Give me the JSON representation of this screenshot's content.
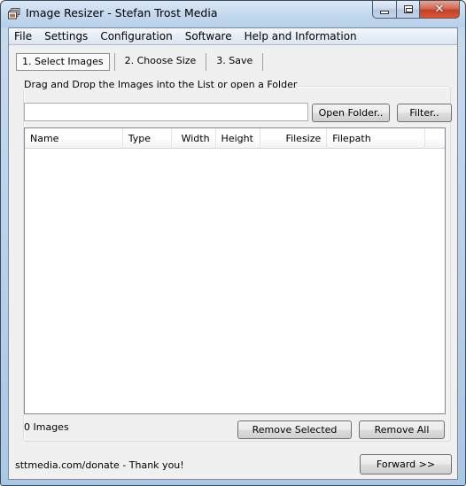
{
  "window": {
    "title": "Image Resizer - Stefan Trost Media",
    "controls": {
      "minimize": "minimize",
      "maximize": "maximize",
      "close": "✕"
    }
  },
  "menu": {
    "items": [
      {
        "label": "File"
      },
      {
        "label": "Settings"
      },
      {
        "label": "Configuration"
      },
      {
        "label": "Software"
      },
      {
        "label": "Help and Information"
      }
    ]
  },
  "tabs": [
    {
      "label": "1. Select Images",
      "active": true
    },
    {
      "label": "2. Choose Size",
      "active": false
    },
    {
      "label": "3. Save",
      "active": false
    }
  ],
  "select_images": {
    "group_label": "Drag and Drop the Images into the List or open a Folder",
    "path_input": {
      "value": "",
      "placeholder": ""
    },
    "open_folder_label": "Open Folder..",
    "filter_label": "Filter..",
    "columns": [
      {
        "label": "Name"
      },
      {
        "label": "Type"
      },
      {
        "label": "Width"
      },
      {
        "label": "Height"
      },
      {
        "label": "Filesize"
      },
      {
        "label": "Filepath"
      },
      {
        "label": ""
      }
    ],
    "rows": [],
    "image_count": "0 Images",
    "remove_selected_label": "Remove Selected",
    "remove_all_label": "Remove All"
  },
  "footer": {
    "donate_text": "sttmedia.com/donate - Thank you!",
    "forward_label": "Forward >>"
  }
}
